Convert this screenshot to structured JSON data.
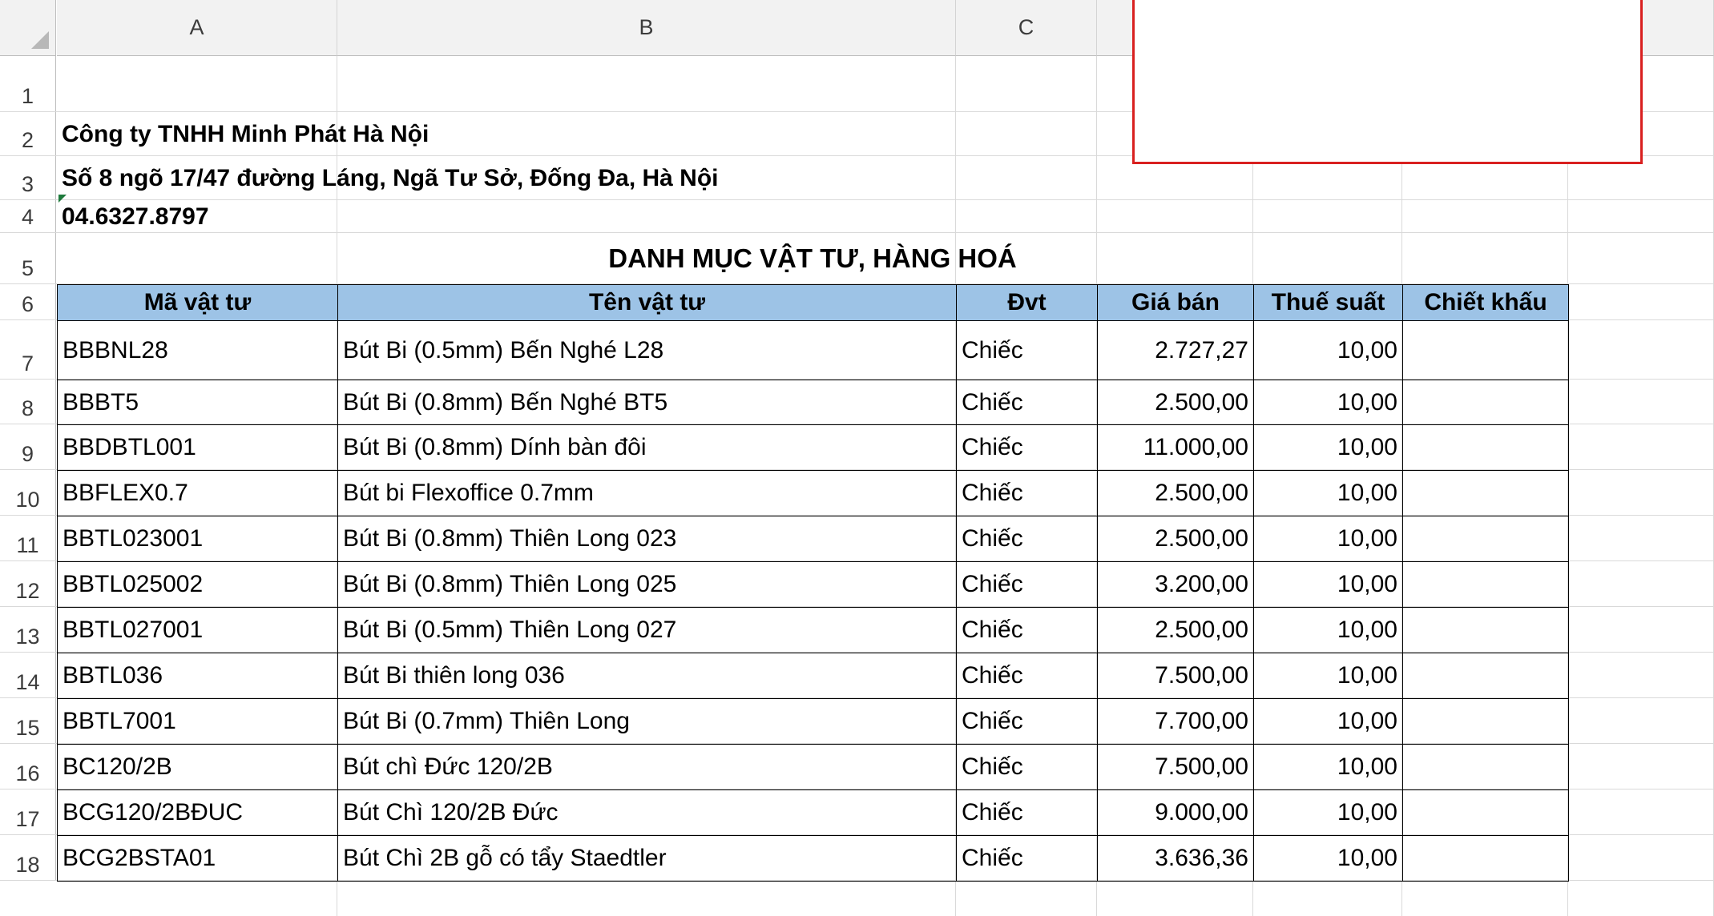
{
  "columns": [
    "A",
    "B",
    "C"
  ],
  "rows": [
    "1",
    "2",
    "3",
    "4",
    "5",
    "6",
    "7",
    "8",
    "9",
    "10",
    "11",
    "12",
    "13",
    "14",
    "15",
    "16",
    "17",
    "18"
  ],
  "header": {
    "company": "Công ty TNHH  Minh Phát Hà Nội",
    "address": "Số 8 ngõ 17/47 đường Láng, Ngã Tư Sở, Đống Đa, Hà Nội",
    "phone": "04.6327.8797",
    "title": "DANH MỤC VẬT TƯ, HÀNG HOÁ"
  },
  "table": {
    "headers": [
      "Mã vật tư",
      "Tên vật tư",
      "Đvt",
      "Giá bán",
      "Thuế suất",
      "Chiết khấu"
    ],
    "rows": [
      {
        "code": "BBBNL28",
        "name": "Bút Bi (0.5mm) Bến Nghé L28",
        "unit": "Chiếc",
        "price": "2.727,27",
        "tax": "10,00",
        "discount": ""
      },
      {
        "code": "BBBT5",
        "name": "Bút Bi (0.8mm) Bến Nghé BT5",
        "unit": "Chiếc",
        "price": "2.500,00",
        "tax": "10,00",
        "discount": ""
      },
      {
        "code": "BBDBTL001",
        "name": "Bút Bi (0.8mm) Dính bàn đôi",
        "unit": "Chiếc",
        "price": "11.000,00",
        "tax": "10,00",
        "discount": ""
      },
      {
        "code": "BBFLEX0.7",
        "name": "Bút bi Flexoffice 0.7mm",
        "unit": "Chiếc",
        "price": "2.500,00",
        "tax": "10,00",
        "discount": ""
      },
      {
        "code": "BBTL023001",
        "name": "Bút Bi (0.8mm) Thiên Long 023",
        "unit": "Chiếc",
        "price": "2.500,00",
        "tax": "10,00",
        "discount": ""
      },
      {
        "code": "BBTL025002",
        "name": "Bút Bi (0.8mm) Thiên Long 025",
        "unit": "Chiếc",
        "price": "3.200,00",
        "tax": "10,00",
        "discount": ""
      },
      {
        "code": "BBTL027001",
        "name": "Bút Bi (0.5mm) Thiên Long 027",
        "unit": "Chiếc",
        "price": "2.500,00",
        "tax": "10,00",
        "discount": ""
      },
      {
        "code": "BBTL036",
        "name": "Bút Bi thiên long 036",
        "unit": "Chiếc",
        "price": "7.500,00",
        "tax": "10,00",
        "discount": ""
      },
      {
        "code": "BBTL7001",
        "name": "Bút Bi (0.7mm) Thiên Long",
        "unit": "Chiếc",
        "price": "7.700,00",
        "tax": "10,00",
        "discount": ""
      },
      {
        "code": "BC120/2B",
        "name": "Bút chì Đức 120/2B",
        "unit": "Chiếc",
        "price": "7.500,00",
        "tax": "10,00",
        "discount": ""
      },
      {
        "code": "BCG120/2BĐUC",
        "name": "Bút Chì 120/2B Đức",
        "unit": "Chiếc",
        "price": "9.000,00",
        "tax": "10,00",
        "discount": ""
      },
      {
        "code": "BCG2BSTA01",
        "name": "Bút Chì 2B gỗ có tẩy Staedtler",
        "unit": "Chiếc",
        "price": "3.636,36",
        "tax": "10,00",
        "discount": ""
      }
    ]
  },
  "colors": {
    "table_header_bg": "#9dc3e6",
    "overlay_border": "#d9201f",
    "error_marker": "#1e7a3c"
  }
}
